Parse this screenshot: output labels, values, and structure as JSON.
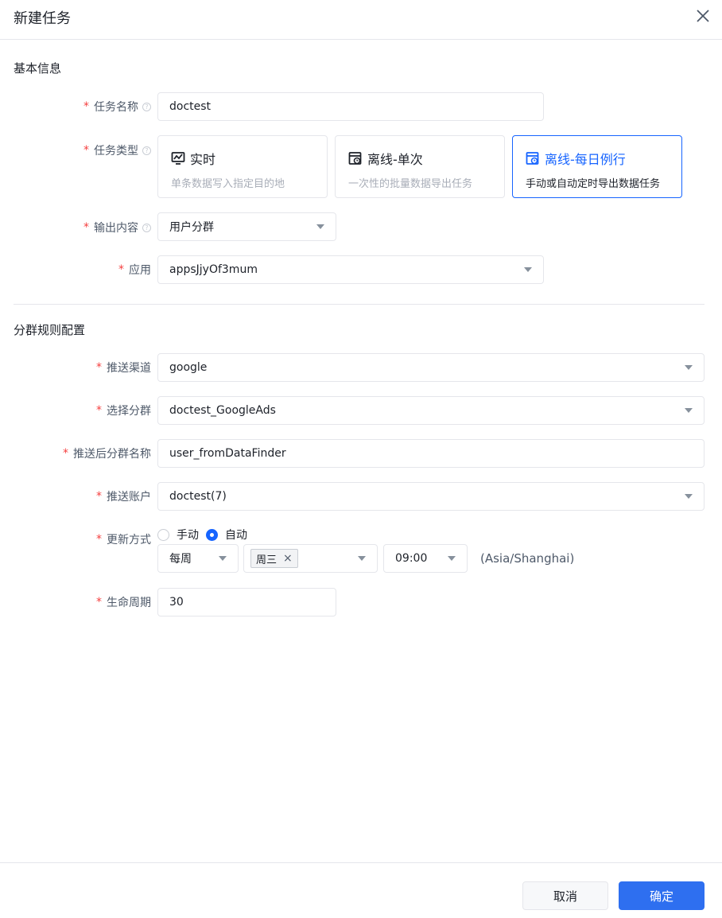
{
  "dialog": {
    "title": "新建任务",
    "close_icon": "close-icon"
  },
  "sections": {
    "basic": "基本信息",
    "rules": "分群规则配置"
  },
  "basic": {
    "task_name": {
      "label": "任务名称",
      "value": "doctest"
    },
    "task_type": {
      "label": "任务类型",
      "cards": [
        {
          "title": "实时",
          "desc": "单条数据写入指定目的地",
          "icon": "monitor-chart-icon",
          "selected": false
        },
        {
          "title": "离线-单次",
          "desc": "一次性的批量数据导出任务",
          "icon": "calendar-clock-icon",
          "selected": false
        },
        {
          "title": "离线-每日例行",
          "desc": "手动或自动定时导出数据任务",
          "icon": "calendar-clock-icon",
          "selected": true
        }
      ]
    },
    "output": {
      "label": "输出内容",
      "value": "用户分群"
    },
    "app": {
      "label": "应用",
      "value": "appsJjyOf3mum"
    }
  },
  "rules": {
    "channel": {
      "label": "推送渠道",
      "value": "google"
    },
    "segment": {
      "label": "选择分群",
      "value": "doctest_GoogleAds"
    },
    "pushed_name": {
      "label": "推送后分群名称",
      "value": "user_fromDataFinder"
    },
    "account": {
      "label": "推送账户",
      "value": "doctest(7)"
    },
    "update": {
      "label": "更新方式",
      "options": [
        "手动",
        "自动"
      ],
      "selected": "自动",
      "frequency": "每周",
      "day_tag": "周三",
      "time": "09:00",
      "timezone": "(Asia/Shanghai)"
    },
    "lifecycle": {
      "label": "生命周期",
      "value": "30"
    }
  },
  "footer": {
    "cancel": "取消",
    "ok": "确定"
  },
  "colors": {
    "primary": "#1664ff",
    "required": "#f53f3f",
    "border": "#e5e6eb"
  }
}
